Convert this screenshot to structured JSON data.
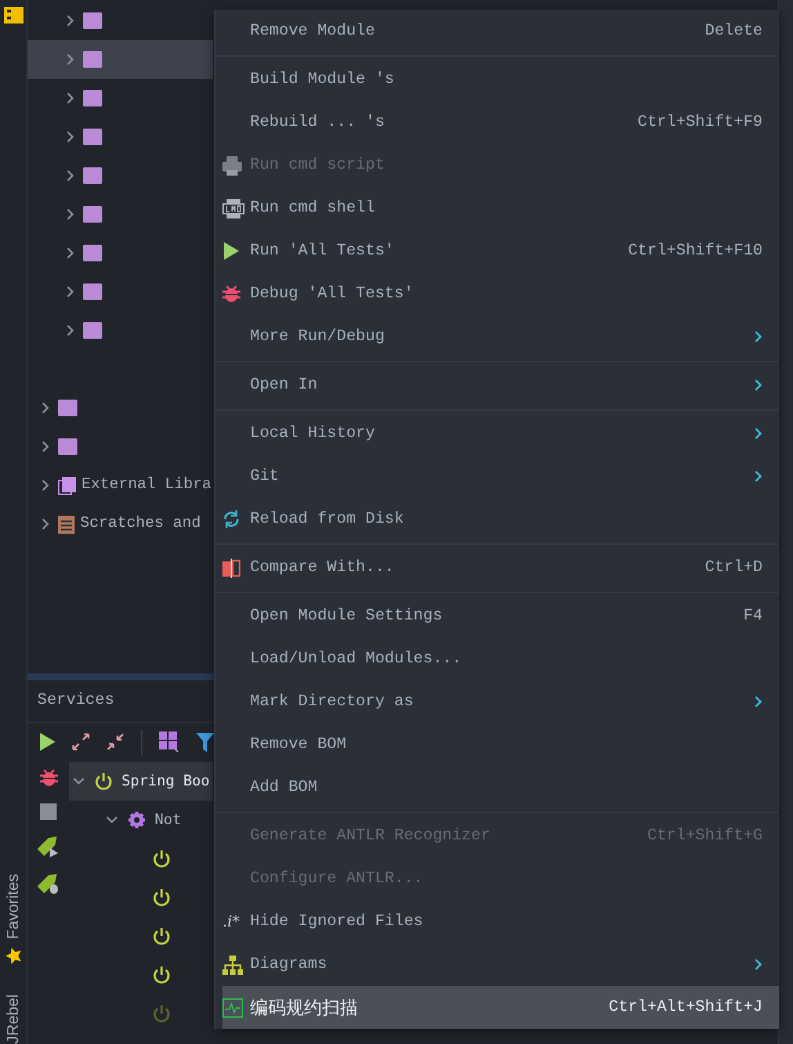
{
  "project_tree": {
    "nested_items": [
      {
        "kind": "folder",
        "expanded": false,
        "selected": false
      },
      {
        "kind": "folder",
        "expanded": false,
        "selected": true
      },
      {
        "kind": "folder",
        "expanded": false,
        "selected": false
      },
      {
        "kind": "folder",
        "expanded": false,
        "selected": false
      },
      {
        "kind": "folder",
        "expanded": false,
        "selected": false
      },
      {
        "kind": "folder",
        "expanded": false,
        "selected": false
      },
      {
        "kind": "folder",
        "expanded": false,
        "selected": false
      },
      {
        "kind": "folder",
        "expanded": false,
        "selected": false
      },
      {
        "kind": "folder",
        "expanded": false,
        "selected": false
      }
    ],
    "items": [
      {
        "kind": "folder",
        "expanded": false,
        "selected": false
      },
      {
        "kind": "folder",
        "expanded": false,
        "selected": false
      },
      {
        "kind": "library",
        "label": "External Libra",
        "expanded": false,
        "selected": false
      },
      {
        "kind": "scratches",
        "label": "Scratches and",
        "expanded": false,
        "selected": false
      }
    ]
  },
  "services": {
    "title": "Services",
    "tree": [
      {
        "label": "Spring Boo",
        "kind": "power",
        "expanded": true,
        "selected": true,
        "disabled": false,
        "children": [
          {
            "label": "Not",
            "kind": "gear",
            "expanded": true,
            "selected": false,
            "disabled": false,
            "children": [
              {
                "kind": "power",
                "selected": false,
                "disabled": false
              },
              {
                "kind": "power",
                "selected": false,
                "disabled": false
              },
              {
                "kind": "power",
                "selected": false,
                "disabled": false
              },
              {
                "kind": "power",
                "selected": false,
                "disabled": false
              },
              {
                "kind": "power",
                "selected": false,
                "disabled": true
              }
            ]
          }
        ]
      }
    ]
  },
  "side_stripe": {
    "tabs": [
      {
        "label": "Favorites",
        "kind": "star"
      },
      {
        "label": "JRebel",
        "kind": "plain"
      }
    ]
  },
  "context_menu": {
    "items": [
      {
        "kind": "plain",
        "label": "Remove Module",
        "shortcut": "Delete",
        "submenu": false,
        "disabled": false,
        "selected": false
      },
      {
        "kind": "separator"
      },
      {
        "kind": "plain",
        "label": "Build Module 's",
        "submenu": false,
        "disabled": false,
        "selected": false
      },
      {
        "kind": "plain",
        "label": "Rebuild ... 's",
        "shortcut": "Ctrl+Shift+F9",
        "submenu": false,
        "disabled": false,
        "selected": false
      },
      {
        "kind": "printer",
        "label": "Run cmd script",
        "submenu": false,
        "disabled": true,
        "selected": false
      },
      {
        "kind": "terminal",
        "label": "Run cmd shell",
        "submenu": false,
        "disabled": false,
        "selected": false
      },
      {
        "kind": "play",
        "label": "Run 'All Tests'",
        "shortcut": "Ctrl+Shift+F10",
        "submenu": false,
        "disabled": false,
        "selected": false
      },
      {
        "kind": "bug",
        "label": "Debug 'All Tests'",
        "submenu": false,
        "disabled": false,
        "selected": false
      },
      {
        "kind": "plain",
        "label": "More Run/Debug",
        "submenu": true,
        "disabled": false,
        "selected": false
      },
      {
        "kind": "separator"
      },
      {
        "kind": "plain",
        "label": "Open In",
        "submenu": true,
        "disabled": false,
        "selected": false
      },
      {
        "kind": "separator"
      },
      {
        "kind": "plain",
        "label": "Local History",
        "submenu": true,
        "disabled": false,
        "selected": false
      },
      {
        "kind": "plain",
        "label": "Git",
        "submenu": true,
        "disabled": false,
        "selected": false
      },
      {
        "kind": "reload",
        "label": "Reload from Disk",
        "submenu": false,
        "disabled": false,
        "selected": false
      },
      {
        "kind": "separator"
      },
      {
        "kind": "compare",
        "label": "Compare With...",
        "shortcut": "Ctrl+D",
        "submenu": false,
        "disabled": false,
        "selected": false
      },
      {
        "kind": "separator"
      },
      {
        "kind": "plain",
        "label": "Open Module Settings",
        "shortcut": "F4",
        "submenu": false,
        "disabled": false,
        "selected": false
      },
      {
        "kind": "plain",
        "label": "Load/Unload Modules...",
        "submenu": false,
        "disabled": false,
        "selected": false
      },
      {
        "kind": "plain",
        "label": "Mark Directory as",
        "submenu": true,
        "disabled": false,
        "selected": false
      },
      {
        "kind": "plain",
        "label": "Remove BOM",
        "submenu": false,
        "disabled": false,
        "selected": false
      },
      {
        "kind": "plain",
        "label": "Add BOM",
        "submenu": false,
        "disabled": false,
        "selected": false
      },
      {
        "kind": "separator"
      },
      {
        "kind": "plain",
        "label": "Generate ANTLR Recognizer",
        "shortcut": "Ctrl+Shift+G",
        "submenu": false,
        "disabled": true,
        "selected": false
      },
      {
        "kind": "plain",
        "label": "Configure ANTLR...",
        "submenu": false,
        "disabled": true,
        "selected": false
      },
      {
        "kind": "ignored",
        "icon_text": ".i*",
        "label": "Hide Ignored Files",
        "submenu": false,
        "disabled": false,
        "selected": false
      },
      {
        "kind": "diagram",
        "label": "Diagrams",
        "submenu": true,
        "disabled": false,
        "selected": false
      },
      {
        "kind": "scan",
        "label": "编码规约扫描",
        "shortcut": "Ctrl+Alt+Shift+J",
        "submenu": false,
        "disabled": false,
        "selected": true
      }
    ]
  }
}
